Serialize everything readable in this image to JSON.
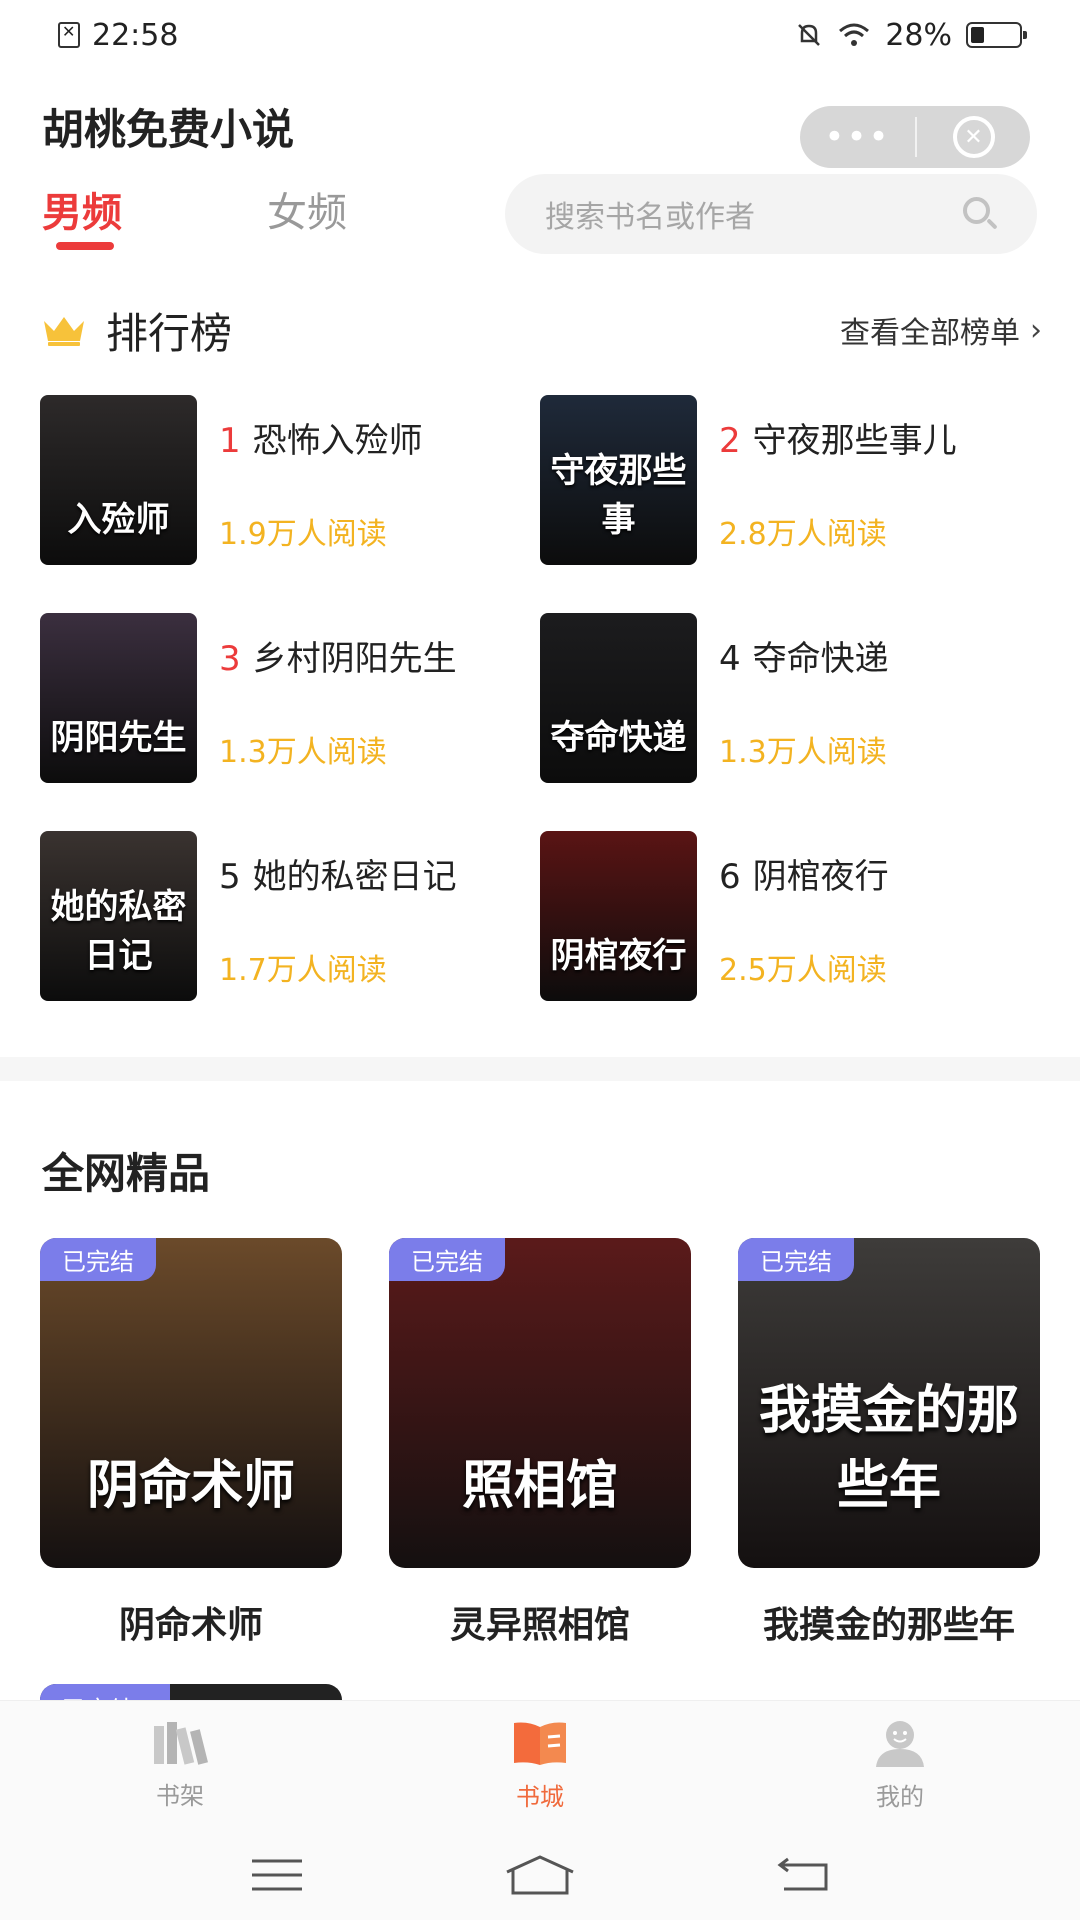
{
  "status_bar": {
    "time": "22:58",
    "battery": "28%",
    "battery_level": 0.28
  },
  "header": {
    "app_title": "胡桃免费小说",
    "capsule_more": "•••",
    "capsule_close": "✕"
  },
  "tabs": [
    {
      "label": "男频",
      "active": true
    },
    {
      "label": "女频",
      "active": false
    }
  ],
  "search": {
    "placeholder": "搜索书名或作者"
  },
  "ranking": {
    "title": "排行榜",
    "view_all": "查看全部榜单",
    "items": [
      {
        "rank": "1",
        "name": "恐怖入殓师",
        "reads": "1.9万人阅读",
        "cover_text": "入殓师",
        "cover_color": "#2d2a2a"
      },
      {
        "rank": "2",
        "name": "守夜那些事儿",
        "reads": "2.8万人阅读",
        "cover_text": "守夜那些事",
        "cover_color": "#1f2a3a"
      },
      {
        "rank": "3",
        "name": "乡村阴阳先生",
        "reads": "1.3万人阅读",
        "cover_text": "阴阳先生",
        "cover_color": "#3b2f3f"
      },
      {
        "rank": "4",
        "name": "夺命快递",
        "reads": "1.3万人阅读",
        "cover_text": "夺命快递",
        "cover_color": "#1c1c1e"
      },
      {
        "rank": "5",
        "name": "她的私密日记",
        "reads": "1.7万人阅读",
        "cover_text": "她的私密日记",
        "cover_color": "#3a3330"
      },
      {
        "rank": "6",
        "name": "阴棺夜行",
        "reads": "2.5万人阅读",
        "cover_text": "阴棺夜行",
        "cover_color": "#5a1414"
      }
    ]
  },
  "boutique": {
    "title": "全网精品",
    "badge": "已完结",
    "books": [
      {
        "title": "阴命术师",
        "cover_text": "阴命术师",
        "cover_color": "#6b4a2a"
      },
      {
        "title": "灵异照相馆",
        "cover_text": "照相馆",
        "cover_color": "#5b1a1a"
      },
      {
        "title": "我摸金的那些年",
        "cover_text": "我摸金的那些年",
        "cover_color": "#3e3c3a"
      }
    ]
  },
  "bottom_nav": [
    {
      "label": "书架",
      "icon": "bookshelf-icon",
      "active": false
    },
    {
      "label": "书城",
      "icon": "book-city-icon",
      "active": true
    },
    {
      "label": "我的",
      "icon": "profile-icon",
      "active": false
    }
  ],
  "colors": {
    "accent": "#ec3b3b",
    "reads": "#f3b321",
    "badge": "#7b7dea",
    "nav_active": "#f06a3c"
  }
}
